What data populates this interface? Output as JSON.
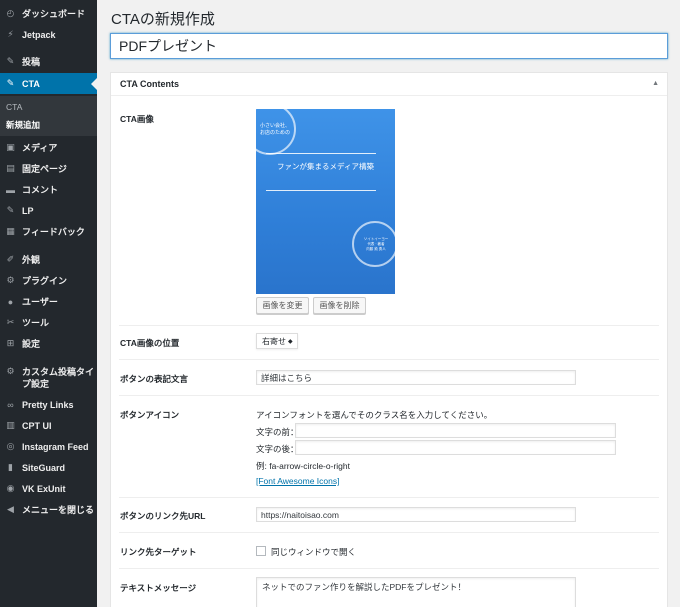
{
  "sidebar": {
    "items": [
      {
        "label": "ダッシュボード",
        "icon": "dashboard-icon",
        "glyph": "◴"
      },
      {
        "label": "Jetpack",
        "icon": "jetpack-icon",
        "glyph": "⚡"
      },
      {
        "label": "投稿",
        "icon": "pin-icon",
        "glyph": "✎"
      },
      {
        "label": "CTA",
        "icon": "pin-icon",
        "glyph": "✎"
      },
      {
        "label": "メディア",
        "icon": "media-icon",
        "glyph": "▣"
      },
      {
        "label": "固定ページ",
        "icon": "page-icon",
        "glyph": "▤"
      },
      {
        "label": "コメント",
        "icon": "comment-icon",
        "glyph": "▬"
      },
      {
        "label": "LP",
        "icon": "pin-icon",
        "glyph": "✎"
      },
      {
        "label": "フィードバック",
        "icon": "feedback-icon",
        "glyph": "▦"
      },
      {
        "label": "外観",
        "icon": "appearance-icon",
        "glyph": "✐"
      },
      {
        "label": "プラグイン",
        "icon": "plugin-icon",
        "glyph": "⚙"
      },
      {
        "label": "ユーザー",
        "icon": "user-icon",
        "glyph": "●"
      },
      {
        "label": "ツール",
        "icon": "wrench-icon",
        "glyph": "✂"
      },
      {
        "label": "設定",
        "icon": "settings-icon",
        "glyph": "⊞"
      },
      {
        "label": "カスタム投稿タイプ設定",
        "icon": "gear-icon",
        "glyph": "⚙"
      },
      {
        "label": "Pretty Links",
        "icon": "pretty-links-icon",
        "glyph": "∞"
      },
      {
        "label": "CPT UI",
        "icon": "cpt-ui-icon",
        "glyph": "▥"
      },
      {
        "label": "Instagram Feed",
        "icon": "instagram-icon",
        "glyph": "◎"
      },
      {
        "label": "SiteGuard",
        "icon": "siteguard-icon",
        "glyph": "▮"
      },
      {
        "label": "VK ExUnit",
        "icon": "vk-exunit-icon",
        "glyph": "◉"
      },
      {
        "label": "メニューを閉じる",
        "icon": "collapse-icon",
        "glyph": "◀"
      }
    ],
    "submenu": [
      "CTA",
      "新規追加"
    ]
  },
  "page": {
    "title": "CTAの新規作成",
    "post_title": "PDFプレゼント"
  },
  "metabox": {
    "title": "CTA Contents",
    "toggle": "▲",
    "fields": {
      "image_label": "CTA画像",
      "image_position_label": "CTA画像の位置",
      "button_text_label": "ボタンの表記文言",
      "button_icon_label": "ボタンアイコン",
      "link_url_label": "ボタンのリンク先URL",
      "link_target_label": "リンク先ターゲット",
      "message_label": "テキストメッセージ"
    },
    "image": {
      "small_text_line1": "小さい会社、",
      "small_text_line2": "お店のための",
      "book_title": "ファンが集まるメディア構築",
      "author_line1": "ソイトイーヨー",
      "author_line2": "代表 · 著者",
      "author_line3": "内藤 勲 勇人"
    },
    "change_image_button": "画像を変更",
    "delete_image_button": "画像を削除",
    "image_position_value": "右寄せ",
    "button_text_value": "詳細はこちら",
    "icon_help": "アイコンフォントを選んでそのクラス名を入力してください。",
    "icon_before_label": "文字の前：",
    "icon_after_label": "文字の後：",
    "icon_before_value": "",
    "icon_after_value": "",
    "icon_example": "例: fa-arrow-circle-o-right",
    "font_awesome_link": "[Font Awesome Icons]",
    "link_url_value": "https://naitoisao.com",
    "link_target_checkbox_label": "同じウィンドウで開く",
    "message_value": "ネットでのファン作りを解説したPDFをプレゼント！"
  },
  "colors": {
    "sidebar_bg": "#23282d",
    "active_menu": "#0073aa",
    "link": "#0073aa"
  }
}
